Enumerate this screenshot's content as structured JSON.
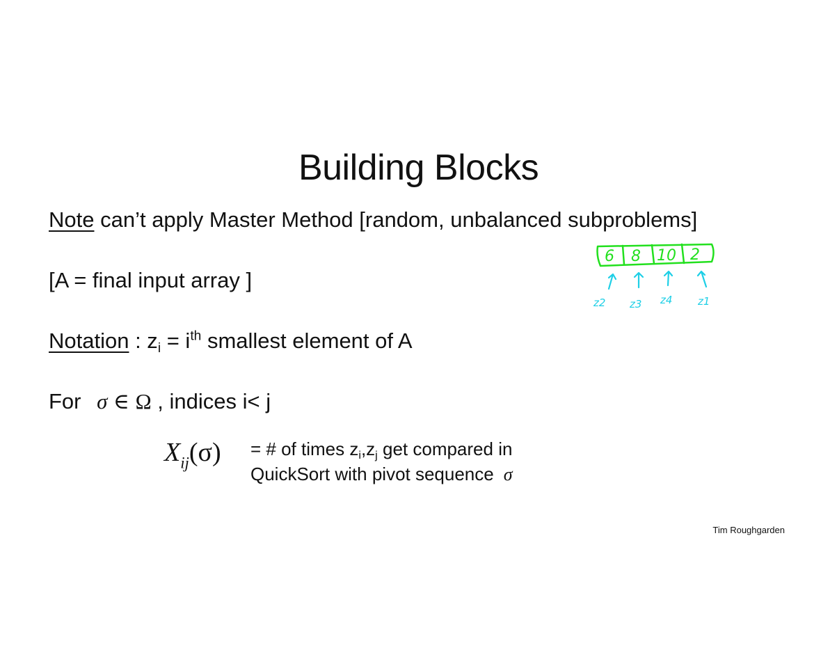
{
  "slide": {
    "title": "Building Blocks",
    "note": {
      "lead": "Note",
      "rest": " can’t apply Master Method [random, unbalanced subproblems]"
    },
    "array_def": "[A = final input array ]",
    "notation": {
      "lead": "Notation",
      "sep": " : z",
      "sub_i": "i",
      "eq": " = i",
      "sup_th": "th",
      "rest": " smallest element of A"
    },
    "for_line": {
      "for": "For ",
      "sigma": "σ",
      "in": "∈",
      "omega": "Ω",
      "rest": " , indices i< j"
    },
    "formula": {
      "X": "X",
      "sub": "ij",
      "arg": "(σ)"
    },
    "definition": {
      "line1_a": "= # of times z",
      "sub_i": "i",
      "comma": ",z",
      "sub_j": "j",
      "line1_b": " get compared in",
      "line2": "QuickSort with pivot sequence",
      "sigma": "σ"
    },
    "credit": "Tim Roughgarden"
  },
  "annotation": {
    "array_values": [
      "6",
      "8",
      "10",
      "2"
    ],
    "labels": [
      "z2",
      "z3",
      "z4",
      "z1"
    ],
    "box_color": "#22e01e",
    "label_color": "#1ecfe6"
  }
}
